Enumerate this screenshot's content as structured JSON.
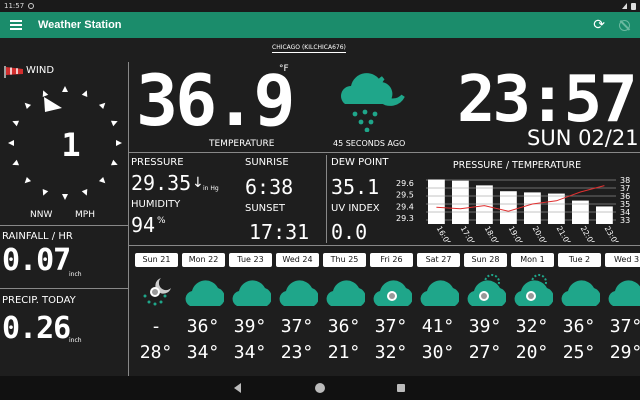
{
  "status": {
    "time": "11:57"
  },
  "appbar": {
    "title": "Weather Station",
    "refresh_glyph": "⟳"
  },
  "station": "CHICAGO (KILCHICA676)",
  "wind": {
    "label": "WIND",
    "direction": "NNW",
    "unit": "MPH",
    "speed": "1"
  },
  "rainfall": {
    "label": "RAINFALL / HR",
    "value": "0.07",
    "unit": "inch"
  },
  "precip": {
    "label": "PRECIP. TODAY",
    "value": "0.26",
    "unit": "inch"
  },
  "temperature": {
    "value": "36.9",
    "unit": "°F",
    "label": "TEMPERATURE"
  },
  "updated": "45 SECONDS AGO",
  "clock": {
    "time": "23:57",
    "date": "SUN 02/21"
  },
  "pressure": {
    "label": "PRESSURE",
    "value": "29.35",
    "arrow": "↓",
    "unit": "in Hg"
  },
  "humidity": {
    "label": "HUMIDITY",
    "value": "94",
    "unit": "%"
  },
  "sunrise": {
    "label": "SUNRISE",
    "value": "6:38"
  },
  "sunset": {
    "label": "SUNSET",
    "value": "17:31"
  },
  "dew_point": {
    "label": "DEW POINT",
    "value": "35.1"
  },
  "uv": {
    "label": "UV INDEX",
    "value": "0.0"
  },
  "colors": {
    "accent": "#1b8c6b",
    "icon": "#1fa68a",
    "bars": "#ffffff",
    "temp_line": "#e03030"
  },
  "chart_data": {
    "type": "bar",
    "title": "PRESSURE / TEMPERATURE",
    "categories": [
      "16:00",
      "17:00",
      "18:00",
      "19:00",
      "20:00",
      "21:00",
      "22:00",
      "23:00"
    ],
    "y_left_ticks": [
      "29.6",
      "29.5",
      "29.4",
      "29.3"
    ],
    "y_right_ticks": [
      "38",
      "37",
      "36",
      "35",
      "34",
      "33"
    ],
    "series": [
      {
        "values": [
          29.63,
          29.62,
          29.58,
          29.53,
          29.52,
          29.51,
          29.45,
          29.4
        ]
      },
      {
        "values": [
          34.6,
          34.4,
          34.8,
          34.1,
          35.0,
          35.4,
          36.5,
          37.3
        ]
      }
    ],
    "ylim_left": [
      29.25,
      29.66
    ],
    "ylim_right": [
      32.5,
      38.5
    ]
  },
  "forecast": [
    {
      "day": "Sun 21",
      "icon": "night-rain-icon",
      "hi": "-",
      "lo": "28°"
    },
    {
      "day": "Mon 22",
      "icon": "cloud-icon",
      "hi": "36°",
      "lo": "34°"
    },
    {
      "day": "Tue 23",
      "icon": "cloud-icon",
      "hi": "39°",
      "lo": "34°"
    },
    {
      "day": "Wed 24",
      "icon": "cloud-icon",
      "hi": "37°",
      "lo": "23°"
    },
    {
      "day": "Thu 25",
      "icon": "cloud-icon",
      "hi": "36°",
      "lo": "21°"
    },
    {
      "day": "Fri 26",
      "icon": "cloud-snow-icon",
      "hi": "37°",
      "lo": "32°"
    },
    {
      "day": "Sat 27",
      "icon": "cloud-icon",
      "hi": "41°",
      "lo": "30°"
    },
    {
      "day": "Sun 28",
      "icon": "sun-cloud-rain-icon",
      "hi": "39°",
      "lo": "27°"
    },
    {
      "day": "Mon 1",
      "icon": "sun-cloud-rain-icon",
      "hi": "32°",
      "lo": "20°"
    },
    {
      "day": "Tue 2",
      "icon": "cloud-icon",
      "hi": "36°",
      "lo": "25°"
    },
    {
      "day": "Wed 3",
      "icon": "cloud-icon",
      "hi": "37°",
      "lo": "29°"
    }
  ]
}
